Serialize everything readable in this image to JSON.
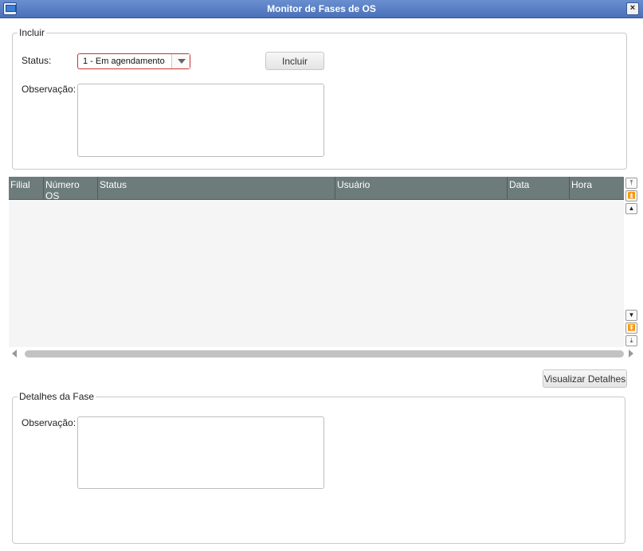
{
  "window": {
    "title": "Monitor de Fases de OS",
    "close_label": "×"
  },
  "incluir": {
    "legend": "Incluir",
    "status_label": "Status:",
    "status_value": "1 - Em agendamento",
    "include_button": "Incluir",
    "observacao_label": "Observação:",
    "observacao_value": ""
  },
  "grid": {
    "columns": [
      "Filial",
      "Número OS",
      "Status",
      "Usuário",
      "Data",
      "Hora"
    ],
    "rows": []
  },
  "actions": {
    "details_button": "Visualizar Detalhes"
  },
  "detalhes": {
    "legend": "Detalhes da Fase",
    "observacao_label": "Observação:",
    "observacao_value": ""
  },
  "colors": {
    "titlebar": "#4a70b8",
    "grid_header": "#6d7b7b",
    "select_border": "#cc3333"
  }
}
